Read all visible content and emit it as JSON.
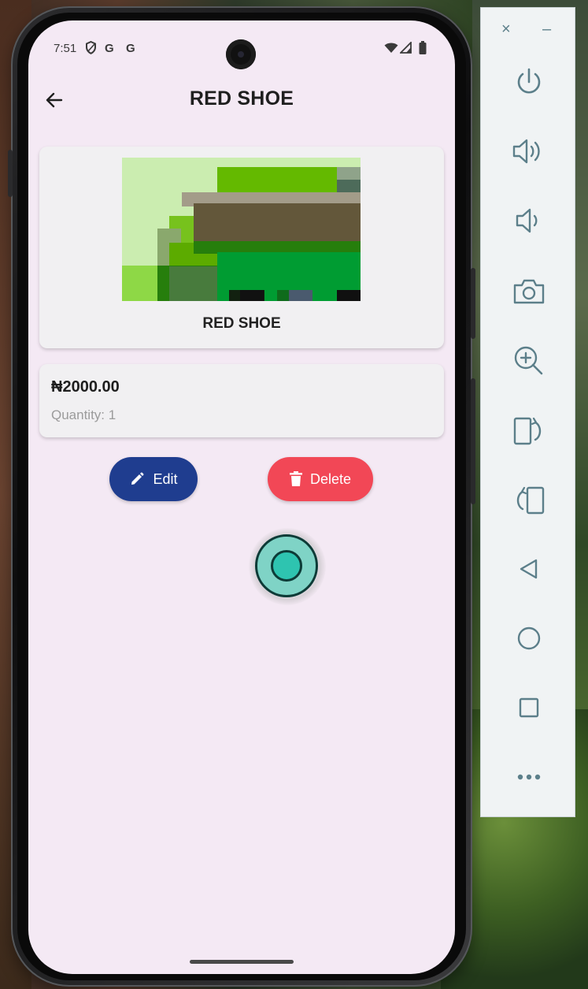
{
  "status_bar": {
    "time": "7:51",
    "icons": [
      "shield-icon",
      "google-icon",
      "google-icon",
      "wifi-icon",
      "signal-icon",
      "battery-icon"
    ],
    "google_label_1": "G",
    "google_label_2": "G"
  },
  "app_bar": {
    "title": "RED SHOE",
    "back_icon": "arrow-left-icon"
  },
  "product": {
    "name": "RED SHOE",
    "price": "₦2000.00",
    "quantity": "Quantity: 1"
  },
  "actions": {
    "edit_label": "Edit",
    "delete_label": "Delete",
    "edit_icon": "pencil-icon",
    "delete_icon": "trash-icon",
    "edit_color": "#1f3d8f",
    "delete_color": "#f24756"
  },
  "emulator_toolbar": {
    "close_label": "×",
    "minimize_label": "–",
    "items": [
      {
        "name": "power",
        "icon": "power-icon"
      },
      {
        "name": "volume-up",
        "icon": "volume-up-icon"
      },
      {
        "name": "volume-down",
        "icon": "volume-down-icon"
      },
      {
        "name": "screenshot",
        "icon": "camera-icon"
      },
      {
        "name": "zoom",
        "icon": "zoom-in-icon"
      },
      {
        "name": "rotate-right",
        "icon": "rotate-right-icon"
      },
      {
        "name": "rotate-left",
        "icon": "rotate-left-icon"
      },
      {
        "name": "back",
        "icon": "back-triangle-icon"
      },
      {
        "name": "home",
        "icon": "home-circle-icon"
      },
      {
        "name": "overview",
        "icon": "overview-square-icon"
      },
      {
        "name": "more",
        "icon": "more-dots-icon"
      }
    ]
  },
  "colors": {
    "screen_background": "#f4e9f4",
    "card_background": "#f1f0f2",
    "toolbar_icon": "#5c7f8a"
  }
}
